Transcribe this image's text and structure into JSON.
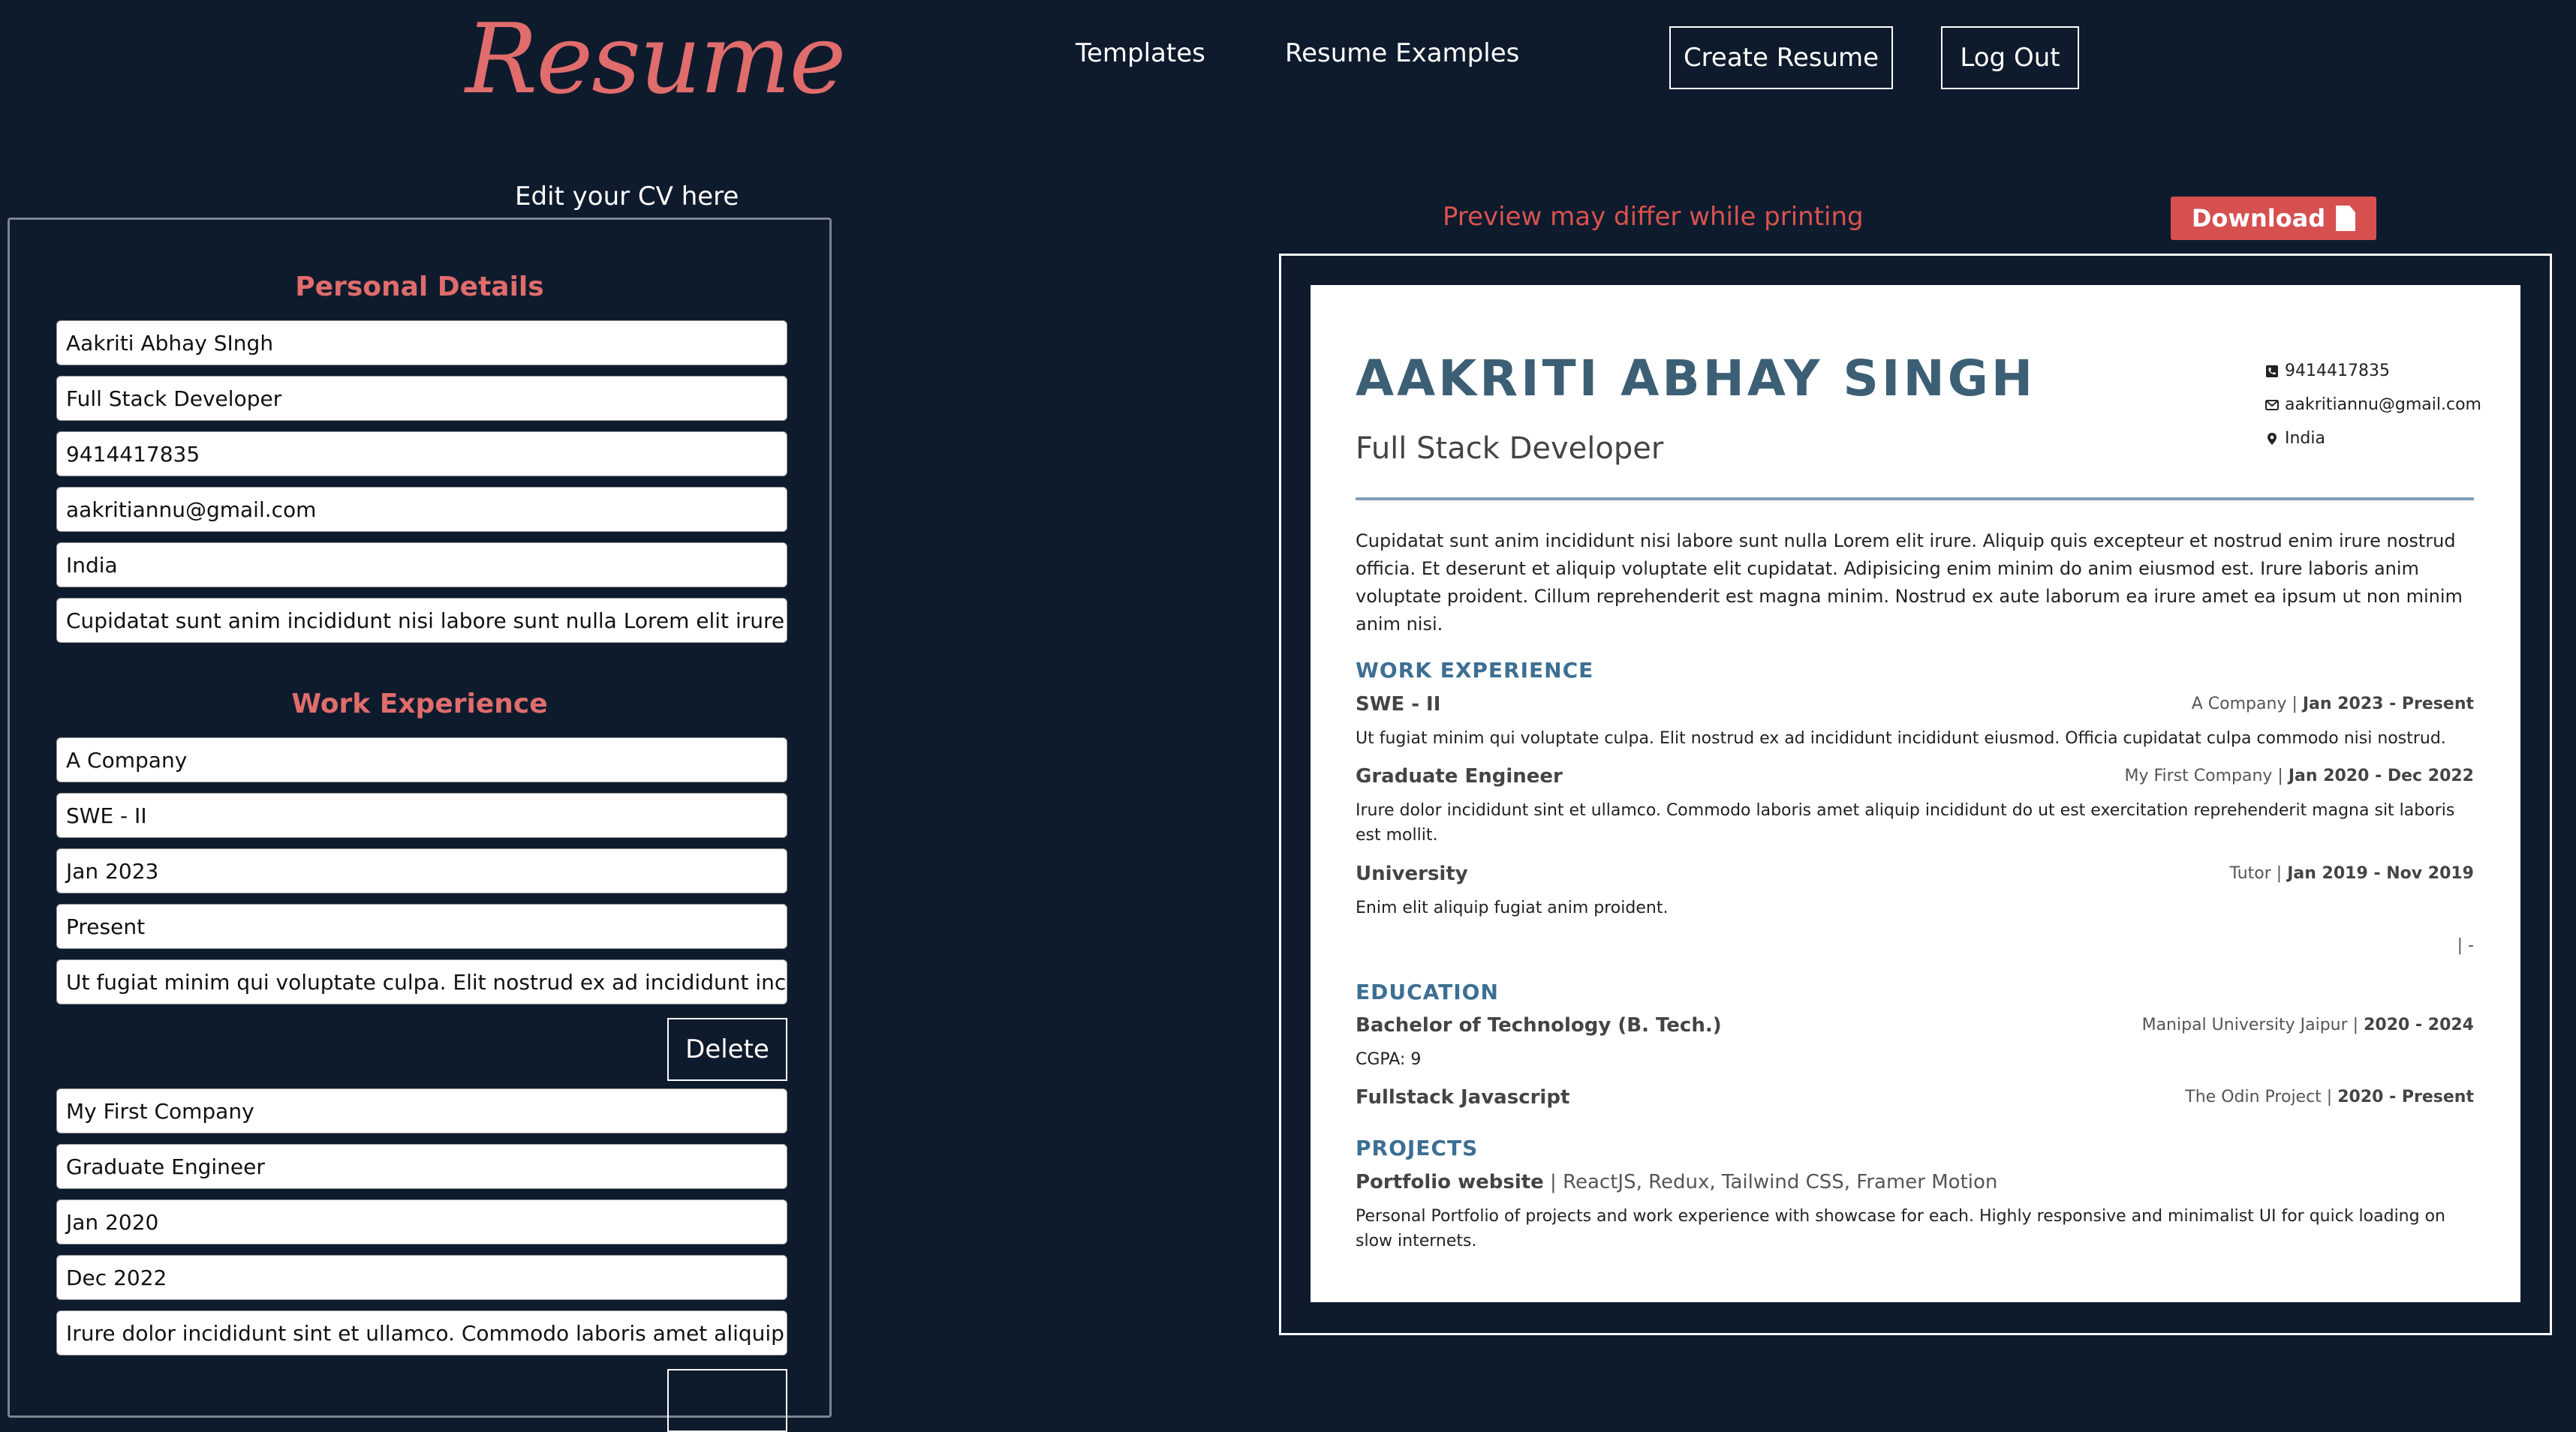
{
  "header": {
    "logo": "Resume",
    "nav": {
      "templates": "Templates",
      "examples": "Resume Examples"
    },
    "create_label": "Create Resume",
    "logout_label": "Log Out"
  },
  "editor": {
    "caption": "Edit your CV here",
    "personal_title": "Personal Details",
    "personal_fields": [
      "Aakriti Abhay SIngh",
      "Full Stack Developer",
      "9414417835",
      "aakritiannu@gmail.com",
      "India",
      "Cupidatat sunt anim incididunt nisi labore sunt nulla Lorem elit irure. Aliqu"
    ],
    "work_title": "Work Experience",
    "job1_fields": [
      "A Company",
      "SWE - II",
      "Jan 2023",
      "Present",
      "Ut fugiat minim qui voluptate culpa. Elit nostrud ex ad incididunt incididu"
    ],
    "delete_label": "Delete",
    "job2_fields": [
      "My First Company",
      "Graduate Engineer",
      "Jan 2020",
      "Dec 2022",
      "Irure dolor incididunt sint et ullamco. Commodo laboris amet aliquip incid"
    ]
  },
  "preview": {
    "note": "Preview may differ while printing",
    "download_label": "Download",
    "resume": {
      "name": "AAKRITI ABHAY SINGH",
      "role": "Full Stack Developer",
      "phone": "9414417835",
      "email": "aakritiannu@gmail.com",
      "location": "India",
      "summary": "Cupidatat sunt anim incididunt nisi labore sunt nulla Lorem elit irure. Aliquip quis excepteur et nostrud enim irure nostrud officia. Et deserunt et aliquip voluptate elit cupidatat. Adipisicing enim minim do anim eiusmod est. Irure laboris anim voluptate proident. Cillum reprehenderit est magna minim. Nostrud ex aute laborum ea irure amet ea ipsum ut non minim anim nisi.",
      "work_heading": "WORK EXPERIENCE",
      "jobs": [
        {
          "title": "SWE - II",
          "company": "A Company |",
          "dates": "Jan 2023 - Present",
          "desc": "Ut fugiat minim qui voluptate culpa. Elit nostrud ex ad incididunt incididunt eiusmod. Officia cupidatat culpa commodo nisi nostrud."
        },
        {
          "title": "Graduate Engineer",
          "company": "My First Company |",
          "dates": "Jan 2020 - Dec 2022",
          "desc": "Irure dolor incididunt sint et ullamco. Commodo laboris amet aliquip incididunt do ut est exercitation reprehenderit magna sit laboris est mollit."
        },
        {
          "title": "University",
          "company": "Tutor |",
          "dates": "Jan 2019 - Nov 2019",
          "desc": "Enim elit aliquip fugiat anim proident."
        }
      ],
      "empty_job": "| -",
      "edu_heading": "EDUCATION",
      "education": [
        {
          "title": "Bachelor of Technology (B. Tech.)",
          "school": "Manipal University Jaipur |",
          "dates": "2020 - 2024",
          "desc": "CGPA: 9"
        },
        {
          "title": "Fullstack Javascript",
          "school": "The Odin Project |",
          "dates": "2020 - Present"
        }
      ],
      "proj_heading": "PROJECTS",
      "project": {
        "name": "Portfolio website",
        "stack": " | ReactJS, Redux, Tailwind CSS, Framer Motion",
        "desc": "Personal Portfolio of projects and work experience with showcase for each. Highly responsive and minimalist UI for quick loading on slow internets."
      }
    }
  }
}
